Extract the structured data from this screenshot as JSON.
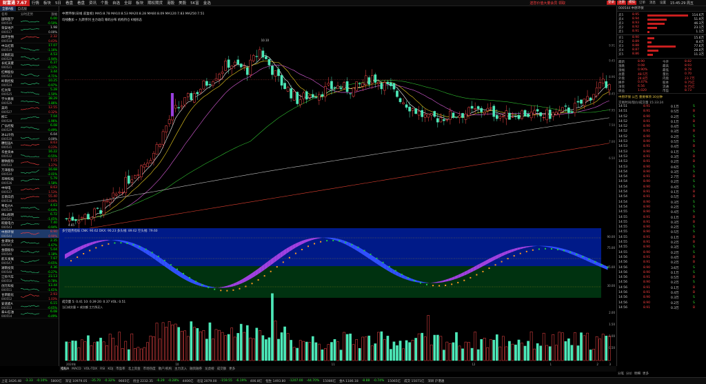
{
  "app": {
    "logo": "财富通 7.67"
  },
  "menu": [
    "行情",
    "板块",
    "5日",
    "看盘",
    "看盘",
    "资讯",
    "个股",
    "自选",
    "全部",
    "板块",
    "期权期货",
    "港股",
    "美股",
    "5K富",
    "金选"
  ],
  "promo": "送您价值大量会员 领取",
  "toolbar": [
    "登录",
    "注册",
    "模拟",
    "订单",
    "消息",
    "设置"
  ],
  "clock": "15:45:29 周五",
  "left": {
    "tabs": [
      "全部A股",
      "自选股"
    ],
    "head": {
      "name": "名称",
      "chart": "分时走势",
      "pct": "涨幅"
    },
    "rows": [
      {
        "name": "国际医学",
        "code": "000516",
        "price": "6.00",
        "chg": "-0.50%",
        "dir": "down"
      },
      {
        "name": "荣安地产",
        "code": "000517",
        "price": "1.98",
        "chg": "0.00%",
        "dir": "flat"
      },
      {
        "name": "四环生物",
        "code": "000518",
        "price": "2.32",
        "chg": "0.43%",
        "dir": "up"
      },
      {
        "name": "中兵红箭",
        "code": "000519",
        "price": "17.07",
        "chg": "-1.16%",
        "dir": "down"
      },
      {
        "name": "凤凰航运",
        "code": "000520",
        "price": "4.53",
        "chg": "-1.94%",
        "dir": "down"
      },
      {
        "name": "长虹美菱",
        "code": "000521",
        "price": "6.37",
        "chg": "-0.12%",
        "dir": "down"
      },
      {
        "name": "红棉股份",
        "code": "000523",
        "price": "3.44",
        "chg": "-4.71%",
        "dir": "down"
      },
      {
        "name": "岭南控股",
        "code": "000524",
        "price": "10.25",
        "chg": "-0.97%",
        "dir": "down"
      },
      {
        "name": "红太阳",
        "code": "000525",
        "price": "5.28",
        "chg": "-1.50%",
        "dir": "down"
      },
      {
        "name": "学大教育",
        "code": "000526",
        "price": "38.29",
        "chg": "-1.86%",
        "dir": "down"
      },
      {
        "name": "美的",
        "code": "000527",
        "price": "12.55",
        "chg": "0.32%",
        "dir": "up"
      },
      {
        "name": "柳工",
        "code": "000528",
        "price": "7.04",
        "chg": "-1.96%",
        "dir": "down"
      },
      {
        "name": "广弘控股",
        "code": "000529",
        "price": "6.08",
        "chg": "-0.49%",
        "dir": "down"
      },
      {
        "name": "冰山冷热",
        "code": "000530",
        "price": "6.04",
        "chg": "0.00%",
        "dir": "flat"
      },
      {
        "name": "穗恒运A",
        "code": "000531",
        "price": "8.63",
        "chg": "0.23%",
        "dir": "up"
      },
      {
        "name": "华金资本",
        "code": "000532",
        "price": "16.22",
        "chg": "-0.55%",
        "dir": "down"
      },
      {
        "name": "顺钠股份",
        "code": "000533",
        "price": "7.15",
        "chg": "1.27%",
        "dir": "up"
      },
      {
        "name": "万泽股份",
        "code": "000534",
        "price": "16.68",
        "chg": "-2.01%",
        "dir": "down"
      },
      {
        "name": "华映科技",
        "code": "000536",
        "price": "5.79",
        "chg": "-1.58%",
        "dir": "down"
      },
      {
        "name": "中绿电",
        "code": "000537",
        "price": "8.63",
        "chg": "1.53%",
        "dir": "up"
      },
      {
        "name": "云南白药",
        "code": "000538",
        "price": "55.40",
        "chg": "0.04%",
        "dir": "up"
      },
      {
        "name": "粤电力A",
        "code": "000539",
        "price": "4.63",
        "chg": "-0.64%",
        "dir": "down"
      },
      {
        "name": "佛山照明",
        "code": "000541",
        "price": "6.72",
        "chg": "-1.45%",
        "dir": "down"
      },
      {
        "name": "皖能电力",
        "code": "000543",
        "price": "7.40",
        "chg": "-0.94%",
        "dir": "down"
      },
      {
        "name": "中原环保",
        "code": "000544",
        "price": "8.90",
        "chg": "0.90%",
        "dir": "up"
      },
      {
        "name": "金浦钛业",
        "code": "000545",
        "price": "2.35",
        "chg": "-1.67%",
        "dir": "down"
      },
      {
        "name": "金圆股份",
        "code": "000546",
        "price": "5.04",
        "chg": "-1.18%",
        "dir": "down"
      },
      {
        "name": "航天发展",
        "code": "000547",
        "price": "7.67",
        "chg": "-0.65%",
        "dir": "down"
      },
      {
        "name": "湖南投资",
        "code": "000548",
        "price": "4.36",
        "chg": "-0.27%",
        "dir": "down"
      },
      {
        "name": "江铃汽车",
        "code": "000550",
        "price": "23.13",
        "chg": "-0.78%",
        "dir": "down"
      },
      {
        "name": "创元科技",
        "code": "000551",
        "price": "13.44",
        "chg": "-1.61%",
        "dir": "down"
      },
      {
        "name": "甘肃能化",
        "code": "000552",
        "price": "2.93",
        "chg": "1.03%",
        "dir": "up"
      },
      {
        "name": "安道麦A",
        "code": "000553",
        "price": "6.15",
        "chg": "-0.65%",
        "dir": "down"
      },
      {
        "name": "泰山石油",
        "code": "000554",
        "price": "6.08",
        "chg": "-0.49%",
        "dir": "down"
      }
    ]
  },
  "main": {
    "header1": "中原环保(日线 前复权) MA5:8.78 MA10:8.53 MA20:8.28 MA60:8.09 MA120:7.83 MA250:7.51",
    "header2": "均线叠加 + 九转序列 主力动向 筹码分布 机构持仓 K线形态",
    "price_axis": [
      "9.91",
      "9.45",
      "8.96",
      "8.45",
      "7.95",
      "7.50",
      "7.00",
      "6.50"
    ],
    "peak_label": "10.10",
    "low_label": "4.65",
    "osc_header": "多空趋势指标 CNK: 90.62 DKX: 90.23 多头线: 89.62 空头线: 79.60",
    "osc_axis": [
      "90.00",
      "75.00",
      "45.00",
      "30.00"
    ],
    "vol_header": "成交量 5: 0.41 10: 0.39 20: 0.37 VOL: 0.51",
    "vol_sub": "当日成交量 + 成交额 主力净买入",
    "vol_axis": [
      "2.00",
      "1.50",
      "1.00",
      "0.50"
    ],
    "x_labels": [
      "2024年",
      "10",
      "11",
      "12",
      "1",
      "2",
      "3"
    ]
  },
  "indicator_tabs": [
    "指标A",
    "MACD",
    "VOL-TDX",
    "RSI",
    "KDJ",
    "市盈率",
    "北上资金",
    "市场热度",
    "散户/机构",
    "主力流入",
    "融资融券",
    "龙虎榜",
    "成交额",
    "更多"
  ],
  "right": {
    "title": "000544 中原环保",
    "ask": [
      {
        "label": "卖5",
        "price": "8.95",
        "vol": "114.6万"
      },
      {
        "label": "卖4",
        "price": "8.94",
        "vol": "51.9万"
      },
      {
        "label": "卖3",
        "price": "8.93",
        "vol": "46.3万"
      },
      {
        "label": "卖2",
        "price": "8.92",
        "vol": "23.1万"
      },
      {
        "label": "卖1",
        "price": "8.91",
        "vol": "1.1万"
      }
    ],
    "bid": [
      {
        "label": "买1",
        "price": "8.90",
        "vol": "15.6万"
      },
      {
        "label": "买2",
        "price": "8.89",
        "vol": "8.4万"
      },
      {
        "label": "买3",
        "price": "8.88",
        "vol": "77.6万"
      },
      {
        "label": "买4",
        "price": "8.87",
        "vol": "28.0万"
      },
      {
        "label": "买5",
        "price": "8.86",
        "vol": "11.3万"
      }
    ],
    "stats": [
      [
        "最新",
        "8.90",
        "今开",
        "8.82"
      ],
      [
        "涨跌",
        "0.08",
        "最高",
        "8.93"
      ],
      [
        "涨幅",
        "0.90%",
        "最低",
        "8.78"
      ],
      [
        "总量",
        "48.5万",
        "量比",
        "0.70"
      ],
      [
        "外盘",
        "24.8万",
        "内盘",
        "23.7万"
      ],
      [
        "换手",
        "0.47%",
        "股本",
        "9.75亿"
      ],
      [
        "净资",
        "6.56",
        "流通",
        "9.75亿"
      ],
      [
        "收益",
        "1.020",
        "市盈",
        "8.73"
      ]
    ],
    "notice": "中原环保 公告 重要事项 30分钟",
    "ticks_header": "交易时间/现价/成交量 15:33:24",
    "ticks": [
      [
        "14:51",
        "8.91",
        "0.1万",
        "S"
      ],
      [
        "14:51",
        "8.91",
        "0.5万",
        "B"
      ],
      [
        "14:52",
        "8.90",
        "0.2万",
        "S"
      ],
      [
        "14:52",
        "8.91",
        "0.1万",
        "B"
      ],
      [
        "14:52",
        "8.90",
        "0.4万",
        "S"
      ],
      [
        "14:52",
        "8.91",
        "0.3万",
        "B"
      ],
      [
        "14:52",
        "8.90",
        "0.2万",
        "S"
      ],
      [
        "14:53",
        "8.90",
        "0.5万",
        "S"
      ],
      [
        "14:53",
        "8.91",
        "0.4万",
        "B"
      ],
      [
        "14:53",
        "8.90",
        "0.1万",
        "S"
      ],
      [
        "14:53",
        "8.91",
        "0.3万",
        "B"
      ],
      [
        "14:53",
        "8.91",
        "0.2万",
        "B"
      ],
      [
        "14:53",
        "8.90",
        "0.6万",
        "S"
      ],
      [
        "14:54",
        "8.90",
        "0.3万",
        "S"
      ],
      [
        "14:54",
        "8.91",
        "2.7万",
        "B"
      ],
      [
        "14:54",
        "8.90",
        "0.2万",
        "S"
      ],
      [
        "14:54",
        "8.90",
        "0.4万",
        "S"
      ],
      [
        "14:54",
        "8.91",
        "0.1万",
        "B"
      ],
      [
        "14:54",
        "8.91",
        "0.5万",
        "B"
      ],
      [
        "14:54",
        "8.90",
        "0.3万",
        "S"
      ],
      [
        "14:54",
        "8.90",
        "0.2万",
        "S"
      ],
      [
        "14:55",
        "8.90",
        "0.4万",
        "S"
      ],
      [
        "14:55",
        "8.91",
        "0.1万",
        "B"
      ],
      [
        "14:55",
        "8.91",
        "0.3万",
        "B"
      ],
      [
        "14:55",
        "8.90",
        "0.2万",
        "S"
      ],
      [
        "14:55",
        "8.90",
        "0.5万",
        "S"
      ],
      [
        "14:55",
        "8.91",
        "0.1万",
        "B"
      ],
      [
        "14:55",
        "8.91",
        "0.2万",
        "B"
      ],
      [
        "14:55",
        "8.90",
        "0.3万",
        "S"
      ],
      [
        "14:55",
        "8.90",
        "0.2万",
        "S"
      ],
      [
        "14:56",
        "8.91",
        "0.4万",
        "B"
      ],
      [
        "14:56",
        "8.91",
        "0.2万",
        "B"
      ],
      [
        "14:56",
        "8.90",
        "3.6万",
        "S"
      ],
      [
        "14:56",
        "8.90",
        "0.1万",
        "S"
      ],
      [
        "14:56",
        "8.91",
        "0.5万",
        "B"
      ],
      [
        "14:56",
        "8.90",
        "0.2万",
        "S"
      ],
      [
        "14:56",
        "8.91",
        "0.1万",
        "B"
      ],
      [
        "14:56",
        "8.91",
        "0.4万",
        "B"
      ],
      [
        "14:56",
        "8.90",
        "0.3万",
        "S"
      ],
      [
        "14:56",
        "8.90",
        "0.2万",
        "S"
      ],
      [
        "14:56",
        "8.91",
        "0.3万",
        "B"
      ]
    ],
    "bottom_tabs": [
      "分笔",
      "分价",
      "明细",
      "更多"
    ]
  },
  "status": [
    "上证 3426.48",
    "-3.33",
    "-0.10%",
    "5800亿",
    "深证 10979.05",
    "-35.70",
    "-0.32%",
    "9665亿",
    "创业 2232.35",
    "-6.29",
    "-0.28%",
    "4406亿",
    "北证 2079.00",
    "-159.55",
    "-6.19%",
    "406.8亿",
    "恒生 1493.80",
    "-1207.00",
    "-44.70%",
    "15086亿",
    "金A 1186.18",
    "-8.88",
    "-0.74%",
    "15065亿",
    "成交 15071亿",
    "深圳 沪港通"
  ],
  "colors": {
    "up": "#ff3b3b",
    "down": "#00e000",
    "bull": "#4de8b8",
    "bear": "#ff4a4a",
    "band_purple": "#a040e0",
    "band_blue": "#3050ff",
    "osc_bg": "#001a88"
  }
}
